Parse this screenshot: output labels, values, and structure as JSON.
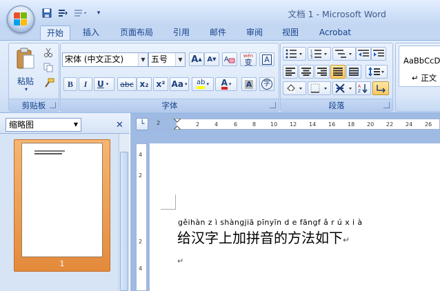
{
  "window": {
    "title": "文档 1 - Microsoft Word"
  },
  "tabs": [
    {
      "label": "开始",
      "active": true
    },
    {
      "label": "插入"
    },
    {
      "label": "页面布局"
    },
    {
      "label": "引用"
    },
    {
      "label": "邮件"
    },
    {
      "label": "审阅"
    },
    {
      "label": "视图"
    },
    {
      "label": "Acrobat"
    }
  ],
  "ribbon": {
    "clipboard": {
      "label": "剪贴板",
      "paste_label": "粘贴"
    },
    "font": {
      "label": "字体",
      "font_name": "宋体 (中文正文)",
      "font_size": "五号",
      "grow": "A",
      "shrink": "A",
      "phonetic": "wén",
      "phonetic_char": "变",
      "border_char": "A",
      "bold": "B",
      "italic": "I",
      "underline": "U",
      "strike": "abc",
      "subscript": "x₂",
      "superscript": "x²",
      "change_case": "Aa",
      "highlight": "ab",
      "font_color": "A",
      "shading_char": "A",
      "enclose_char": "字"
    },
    "paragraph": {
      "label": "段落"
    },
    "styles": {
      "preview": "AaBbCcD",
      "normal_label": "↵ 正文"
    }
  },
  "thumbnails": {
    "view_label": "缩略图",
    "page_number": "1"
  },
  "ruler": {
    "h_ticks": [
      "2",
      "2",
      "4",
      "6",
      "8",
      "10",
      "12",
      "14",
      "16",
      "18",
      "20",
      "22",
      "24",
      "26"
    ],
    "v_ticks": [
      "4",
      "2",
      "2",
      "4"
    ]
  },
  "document": {
    "pinyin": "gěi hàn zì shàng jiā pīn yīn de fāng fǎ rú xià",
    "pinyin_spaced": "gěihàn z ì shàngjiā pīnyīn d e fāngf ǎ r ú x i à",
    "text": "给汉字上加拼音的方法如下",
    "para_mark": "↵"
  }
}
